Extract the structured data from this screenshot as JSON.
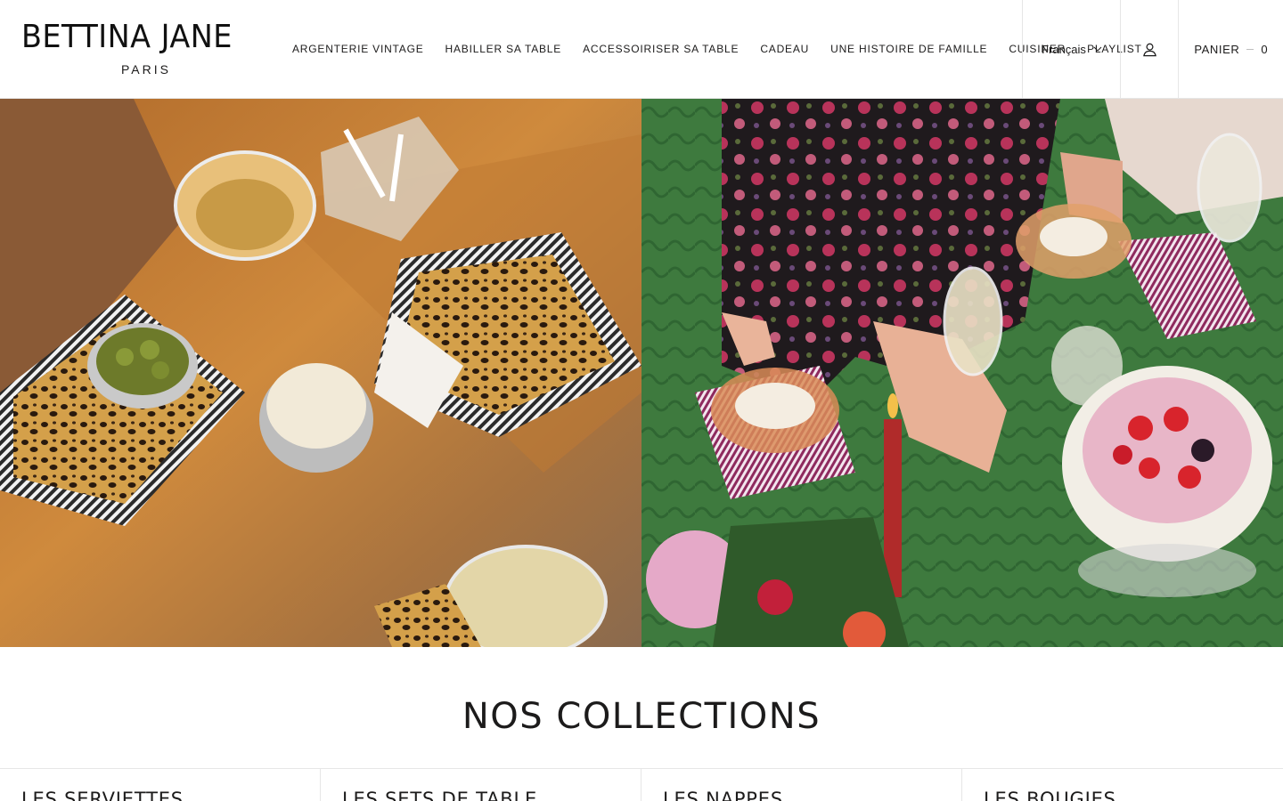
{
  "header": {
    "logo": {
      "name": "BETTINA JANE",
      "city": "PARIS"
    },
    "nav": [
      {
        "label": "ARGENTERIE VINTAGE"
      },
      {
        "label": "HABILLER SA TABLE"
      },
      {
        "label": "ACCESSOIRISER SA TABLE"
      },
      {
        "label": "CADEAU"
      },
      {
        "label": "UNE HISTOIRE DE FAMILLE"
      },
      {
        "label": "CUISINER"
      },
      {
        "label": "PLAYLIST"
      }
    ],
    "language": {
      "label": "Français",
      "icon": "chevron-down-icon"
    },
    "account": {
      "icon": "user-icon"
    },
    "cart": {
      "label": "PANIER",
      "count": "0"
    }
  },
  "hero": {
    "images": [
      {
        "subject": "mirrored table with leopard and striped napkins, coupes, olives and popcorn"
      },
      {
        "subject": "festive green table with striped napkins, dessert cups, candle and pavlova"
      }
    ]
  },
  "collections": {
    "title": "NOS COLLECTIONS",
    "items": [
      {
        "label": "LES SERVIETTES"
      },
      {
        "label": "LES SETS DE TABLE"
      },
      {
        "label": "LES NAPPES"
      },
      {
        "label": "LES BOUGIES"
      }
    ]
  },
  "colors": {
    "text": "#1c1b1b",
    "border": "#e6e6e6",
    "background": "#ffffff"
  }
}
